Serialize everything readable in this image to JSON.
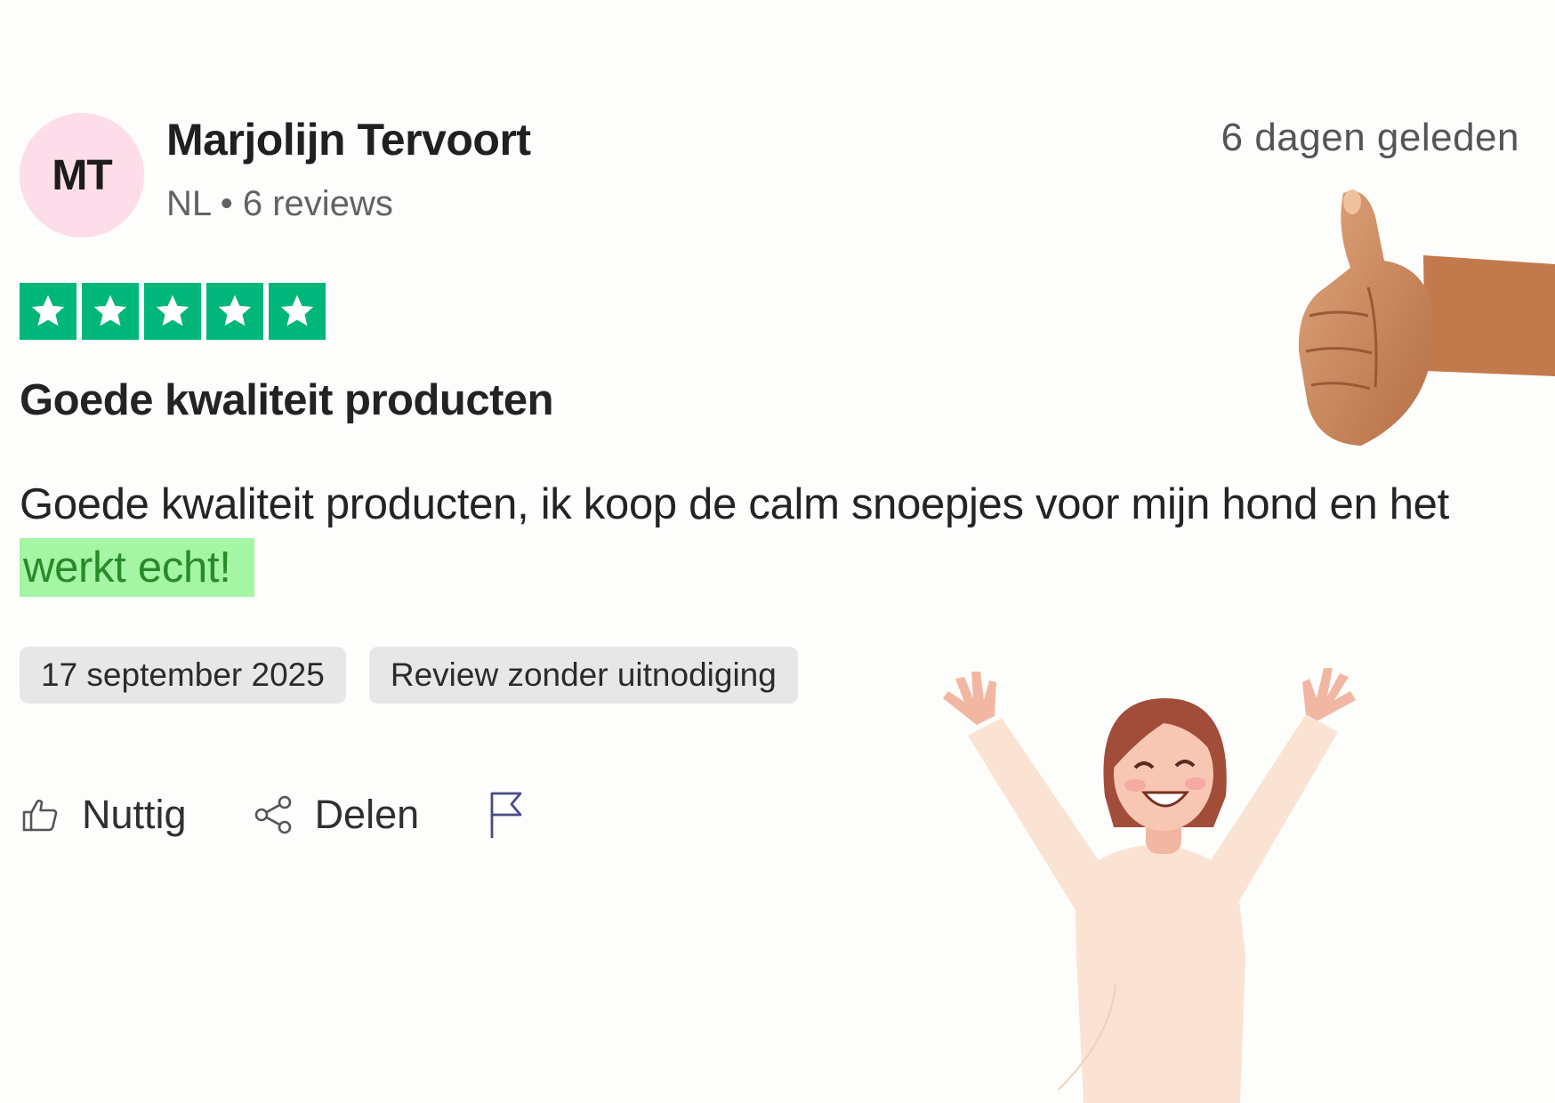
{
  "reviewer": {
    "initials": "MT",
    "name": "Marjolijn Tervoort",
    "meta": "NL • 6 reviews",
    "avatar_color": "#fcdde9"
  },
  "posted_relative": "6 dagen geleden",
  "rating": {
    "stars": 5,
    "max": 5,
    "color": "#00b67a"
  },
  "review": {
    "title": "Goede kwaliteit producten",
    "body_start": "Goede kwaliteit producten, ik koop de calm snoepjes voor mijn hond en het ",
    "body_highlight": "werkt echt!",
    "highlight_color": "#a4f5a4"
  },
  "tags": {
    "date": "17 september 2025",
    "type": "Review zonder uitnodiging"
  },
  "actions": {
    "useful_label": "Nuttig",
    "share_label": "Delen",
    "report_icon": "flag-icon"
  },
  "illustrations": [
    "thumbs-up-hand",
    "cheering-woman"
  ]
}
